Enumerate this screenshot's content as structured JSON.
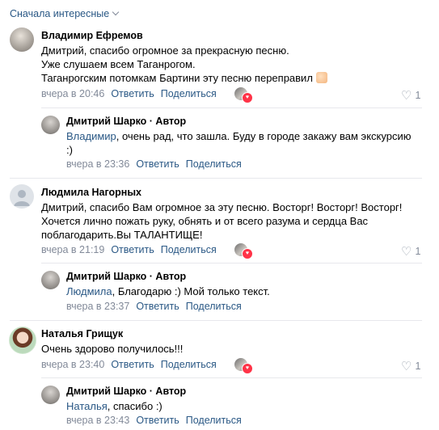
{
  "sort": {
    "label": "Сначала интересные"
  },
  "comments": [
    {
      "author": "Владимир Ефремов",
      "lines": [
        "Дмитрий, спасибо огромное за прекрасную песню.",
        "Уже слушаем всем Таганрогом.",
        "Таганрогским потомкам Бартини эту песню переправил"
      ],
      "emoji": "handshake-emoji",
      "time": "вчера в 20:46",
      "reply_label": "Ответить",
      "share_label": "Поделиться",
      "likes": "1",
      "reply": {
        "author": "Дмитрий Шарко · Автор",
        "mention": "Владимир",
        "lines": [
          ", очень рад, что зашла. Буду в городе закажу вам экскурсию",
          ":)"
        ],
        "time": "вчера в 23:36",
        "reply_label": "Ответить",
        "share_label": "Поделиться"
      }
    },
    {
      "author": "Людмила Нагорных",
      "lines": [
        "Дмитрий, спасибо Вам огромное за эту песню. Восторг! Восторг! Восторг!",
        "Хочется лично пожать руку, обнять и от всего разума и сердца Вас",
        "поблагодарить.Вы ТАЛАНТИЩЕ!"
      ],
      "time": "вчера в 21:19",
      "reply_label": "Ответить",
      "share_label": "Поделиться",
      "likes": "1",
      "reply": {
        "author": "Дмитрий Шарко · Автор",
        "mention": "Людмила",
        "lines": [
          ", Благодарю :) Мой только текст."
        ],
        "time": "вчера в 23:37",
        "reply_label": "Ответить",
        "share_label": "Поделиться"
      }
    },
    {
      "author": "Наталья Грищук",
      "lines": [
        "Очень здорово получилось!!!"
      ],
      "time": "вчера в 23:40",
      "reply_label": "Ответить",
      "share_label": "Поделиться",
      "likes": "1",
      "reply": {
        "author": "Дмитрий Шарко · Автор",
        "mention": "Наталья",
        "lines": [
          ", спасибо :)"
        ],
        "time": "вчера в 23:43",
        "reply_label": "Ответить",
        "share_label": "Поделиться"
      }
    }
  ],
  "colors": {
    "link": "#2a5885",
    "meta": "#828a99",
    "separator": "#e7e8ec",
    "like_badge": "#ff3347"
  }
}
